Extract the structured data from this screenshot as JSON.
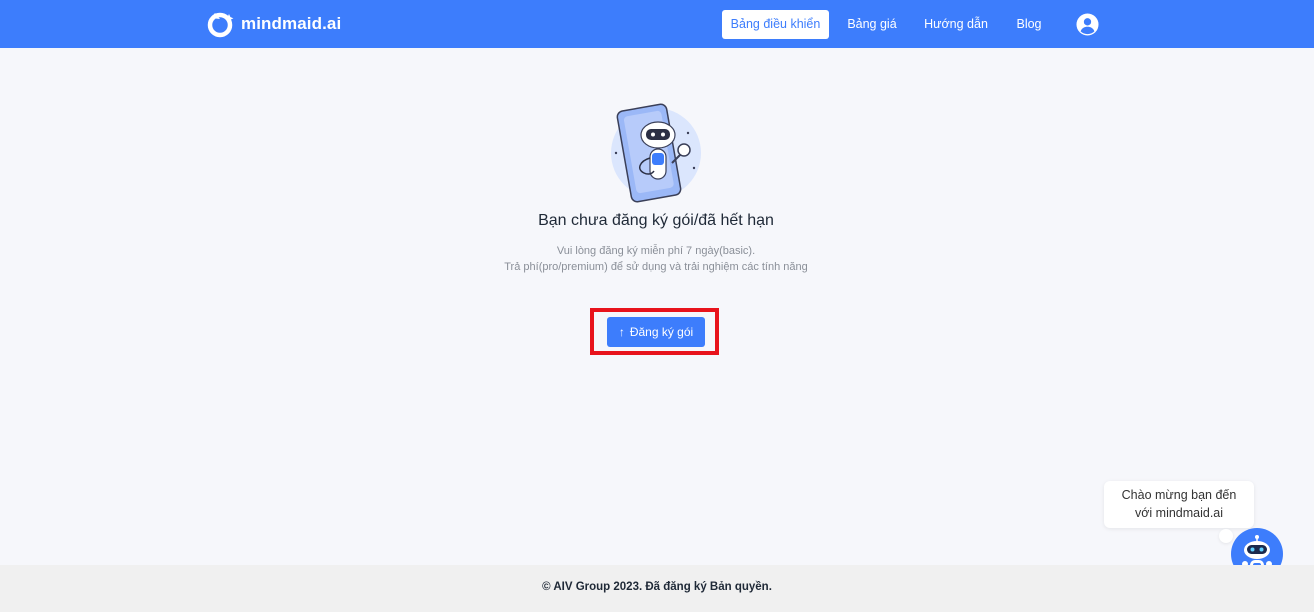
{
  "header": {
    "brand": "mindmaid.ai",
    "nav": [
      {
        "label": "Bảng điều khiển",
        "active": true
      },
      {
        "label": "Bảng giá",
        "active": false
      },
      {
        "label": "Hướng dẫn",
        "active": false
      },
      {
        "label": "Blog",
        "active": false
      }
    ],
    "profile_icon": "user-circle-icon",
    "accent_color": "#3d7dfc"
  },
  "main": {
    "illustration_icon": "robot-phone-illustration",
    "heading": "Bạn chưa đăng ký gói/đã hết hạn",
    "sub_line1": "Vui lòng đăng ký miễn phí 7 ngày(basic).",
    "sub_line2": "Trả phí(pro/premium) để sử dụng và trải nghiệm các tính năng",
    "register_button": {
      "icon": "arrow-up-icon",
      "label": "Đăng ký gói"
    },
    "highlight_color": "#e8131c"
  },
  "chat": {
    "bubble_line1": "Chào mừng bạn đến",
    "bubble_line2": "với mindmaid.ai",
    "launcher_icon": "robot-chat-icon"
  },
  "footer": {
    "text": "© AIV Group 2023. Đã đăng ký Bản quyền."
  }
}
